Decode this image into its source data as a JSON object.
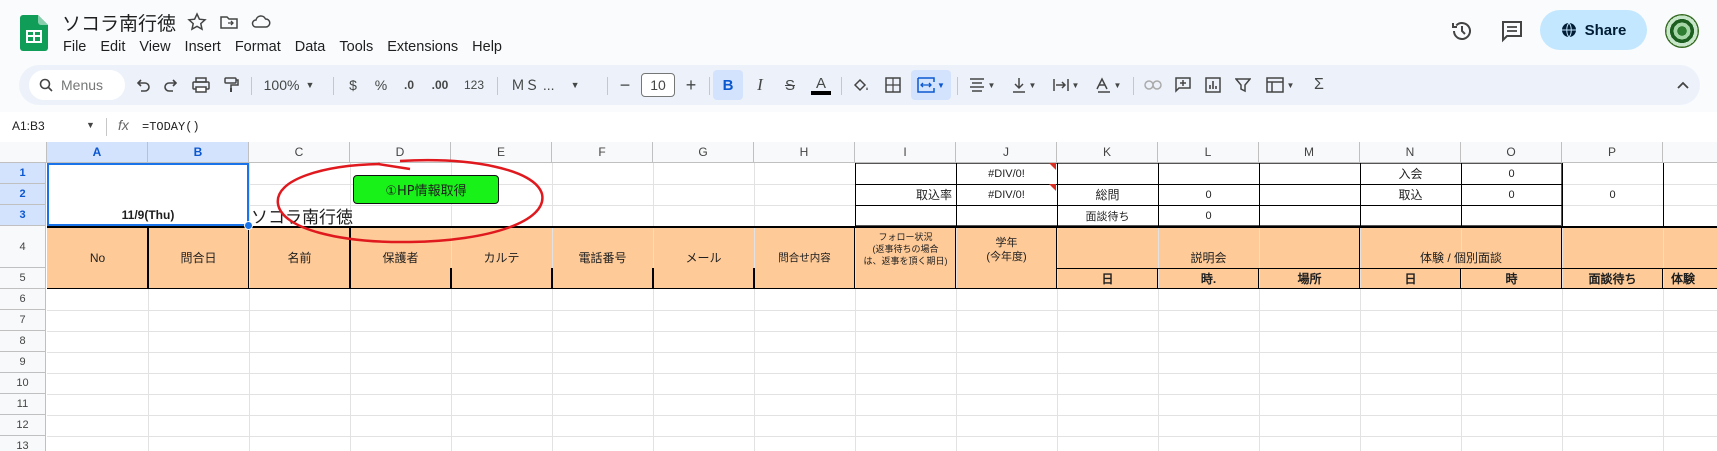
{
  "app": {
    "title": "ソコラ南行徳",
    "menu": [
      "File",
      "Edit",
      "View",
      "Insert",
      "Format",
      "Data",
      "Tools",
      "Extensions",
      "Help"
    ],
    "share": "Share"
  },
  "toolbar": {
    "search": "Menus",
    "zoom": "100%",
    "currency": "$",
    "percent": "%",
    "dec_dec": ".0",
    "dec_inc": ".00",
    "fmt123": "123",
    "font": "ＭＳ ...",
    "fontsize": "10",
    "minus": "−",
    "plus": "+",
    "bold": "B",
    "italic": "I",
    "strike": "S",
    "textcolor": "A",
    "sigma": "Σ"
  },
  "formula_bar": {
    "namebox": "A1:B3",
    "fx": "fx",
    "formula": "=TODAY()"
  },
  "columns": [
    "A",
    "B",
    "C",
    "D",
    "E",
    "F",
    "G",
    "H",
    "I",
    "J",
    "K",
    "L",
    "M",
    "N",
    "O",
    "P"
  ],
  "rows": [
    "1",
    "2",
    "3",
    "4",
    "5",
    "6",
    "7",
    "8",
    "9",
    "10",
    "11",
    "12",
    "13"
  ],
  "cells": {
    "a1": "11/9(Thu)",
    "c3": "ソコラ南行徳",
    "button": "①HP情報取得",
    "j1": "#DIV/0!",
    "j2": "#DIV/0!",
    "i2": "取込率",
    "k2": "総問",
    "k3": "面談待ち",
    "l2": "0",
    "l3": "0",
    "n1": "入会",
    "n2": "取込",
    "o1": "0",
    "o2": "0",
    "p2": "0",
    "h_no": "No",
    "h_date": "問合日",
    "h_name": "名前",
    "h_guardian": "保護者",
    "h_karte": "カルテ",
    "h_phone": "電話番号",
    "h_mail": "メール",
    "h_content": "問合せ内容",
    "h_follow1": "フォロー状況",
    "h_follow2": "(返事待ちの場合",
    "h_follow3": "は、返事を頂く期日)",
    "h_grade1": "学年",
    "h_grade2": "(今年度)",
    "h_briefing": "説明会",
    "h_trial": "体験 / 個別面談",
    "s_day": "日",
    "s_time": "時.",
    "s_place": "場所",
    "s_day2": "日",
    "s_time2": "時",
    "s_wait": "面談待ち",
    "s_exp": "体験"
  }
}
